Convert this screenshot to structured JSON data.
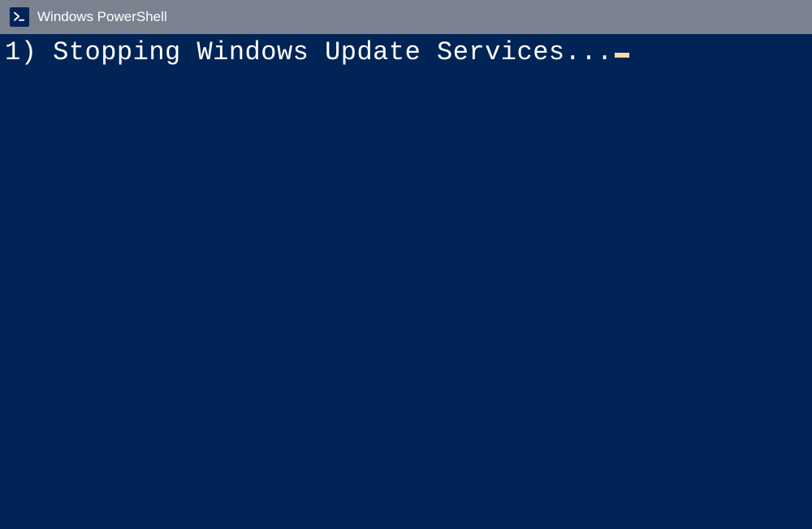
{
  "titlebar": {
    "title": "Windows PowerShell"
  },
  "terminal": {
    "lines": [
      "1) Stopping Windows Update Services..."
    ]
  }
}
